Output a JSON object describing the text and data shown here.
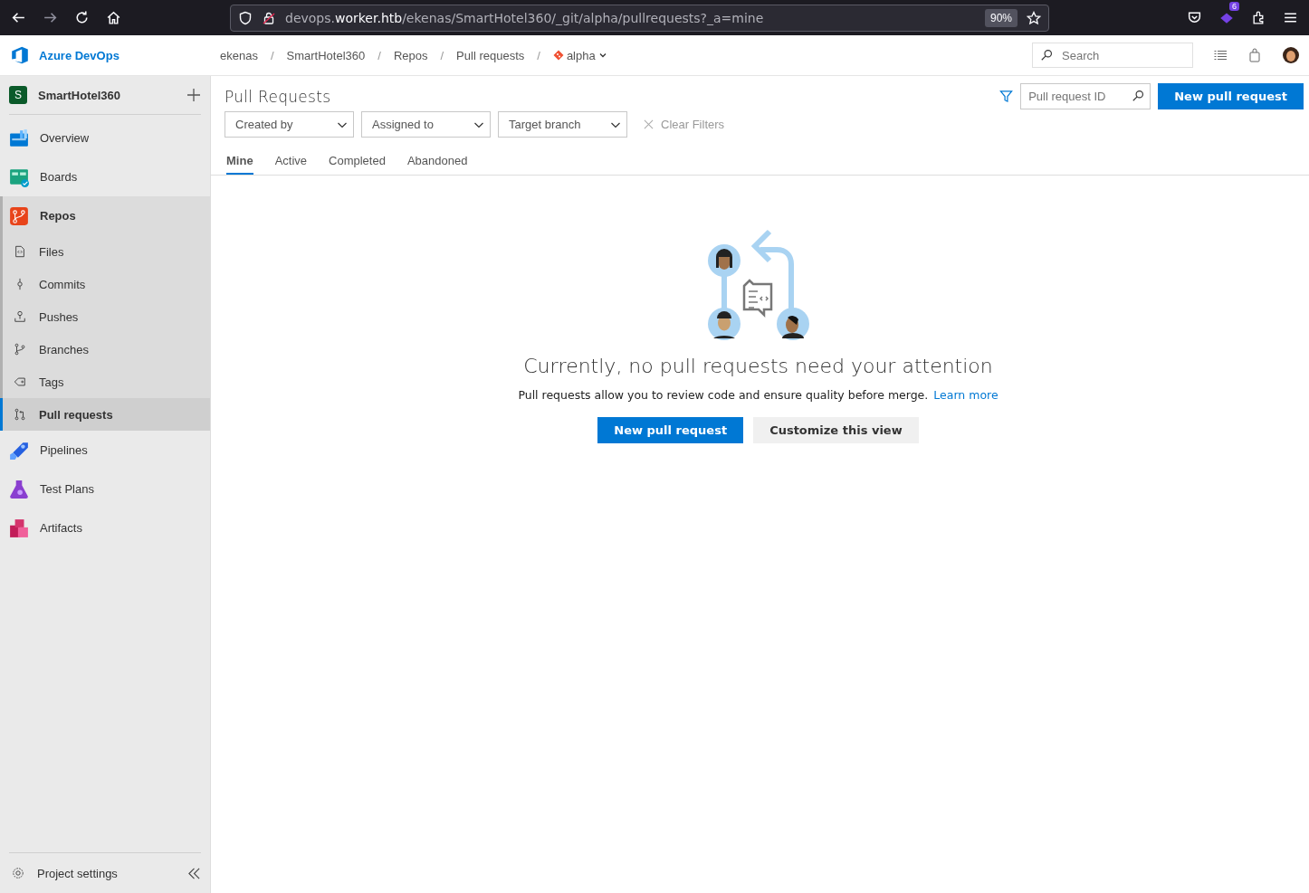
{
  "browser": {
    "url": {
      "prefix": "devops.",
      "domain": "worker.htb",
      "path": "/ekenas/SmartHotel360/_git/alpha/pullrequests?_a=mine"
    },
    "zoom": "90%",
    "extension_badge": "6"
  },
  "header": {
    "product": "Azure DevOps",
    "breadcrumbs": [
      "ekenas",
      "SmartHotel360",
      "Repos",
      "Pull requests"
    ],
    "breadcrumb_separators": [
      "/",
      "/",
      "/",
      "/"
    ],
    "branch": "alpha",
    "search": {
      "placeholder": "Search"
    }
  },
  "sidebar": {
    "project": {
      "initial": "S",
      "name": "SmartHotel360"
    },
    "items": [
      {
        "label": "Overview",
        "selected": false,
        "expanded": false
      },
      {
        "label": "Boards",
        "selected": false,
        "expanded": false
      },
      {
        "label": "Repos",
        "selected": false,
        "expanded": true,
        "children": [
          {
            "label": "Files",
            "selected": false
          },
          {
            "label": "Commits",
            "selected": false
          },
          {
            "label": "Pushes",
            "selected": false
          },
          {
            "label": "Branches",
            "selected": false
          },
          {
            "label": "Tags",
            "selected": false
          },
          {
            "label": "Pull requests",
            "selected": true
          }
        ]
      },
      {
        "label": "Pipelines",
        "selected": false,
        "expanded": false
      },
      {
        "label": "Test Plans",
        "selected": false,
        "expanded": false
      },
      {
        "label": "Artifacts",
        "selected": false,
        "expanded": false
      }
    ],
    "footer": "Project settings"
  },
  "page": {
    "title": "Pull Requests",
    "id_search": {
      "placeholder": "Pull request ID"
    },
    "new_button": "New pull request",
    "filters": [
      "Created by",
      "Assigned to",
      "Target branch"
    ],
    "clear_filters": "Clear Filters",
    "tabs": [
      {
        "label": "Mine",
        "selected": true
      },
      {
        "label": "Active",
        "selected": false
      },
      {
        "label": "Completed",
        "selected": false
      },
      {
        "label": "Abandoned",
        "selected": false
      }
    ],
    "empty": {
      "heading": "Currently, no pull requests need your attention",
      "text": "Pull requests allow you to review code and ensure quality before merge.",
      "link": "Learn more",
      "primary": "New pull request",
      "secondary": "Customize this view"
    }
  }
}
